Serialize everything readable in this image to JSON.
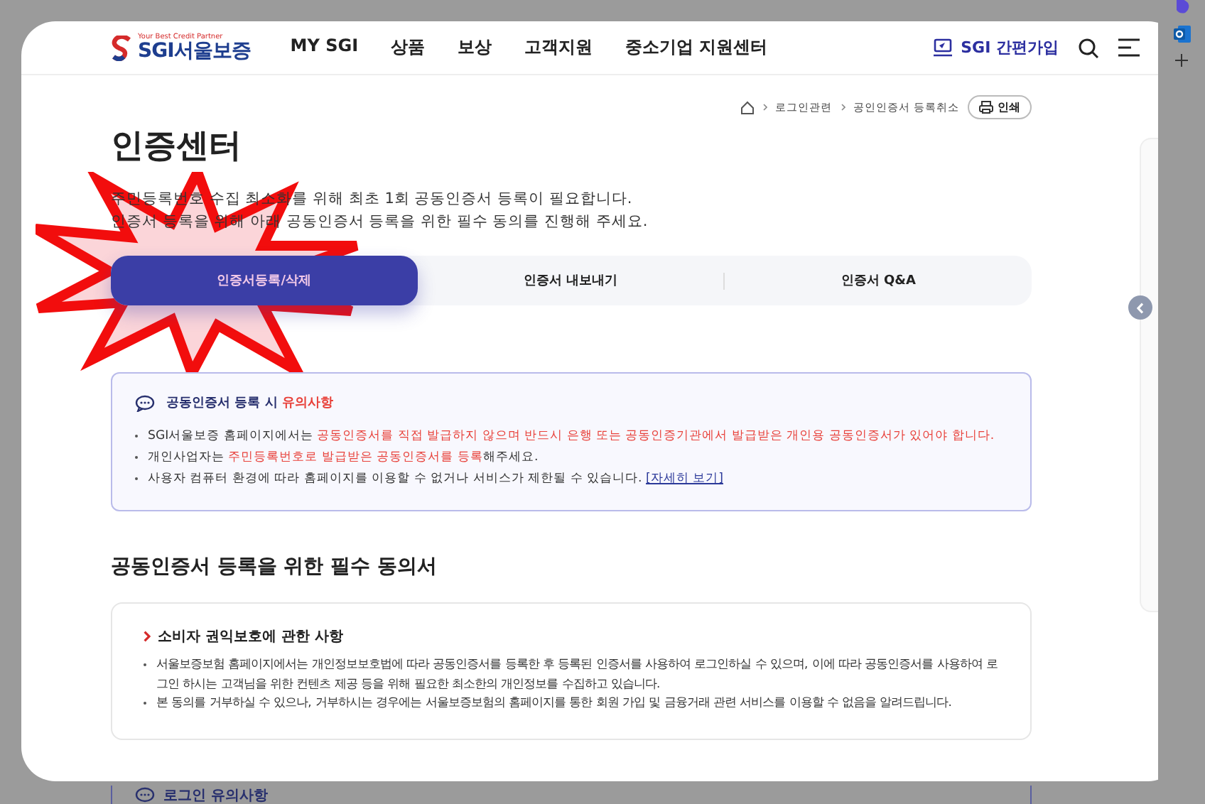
{
  "header": {
    "logo_tagline": "Your Best Credit Partner",
    "logo_text": "SGI서울보증",
    "nav": [
      "MY SGI",
      "상품",
      "보상",
      "고객지원",
      "중소기업 지원센터"
    ],
    "signup": "SGI 간편가입"
  },
  "breadcrumb": [
    "로그인관련",
    "공인인증서 등록취소"
  ],
  "print_button": "인쇄",
  "title": "인증센터",
  "intro": [
    "주민등록번호 수집 최소화를 위해 최초 1회 공동인증서 등록이 필요합니다.",
    "인증서 등록을 위해 아래 공동인증서 등록을 위한 필수 동의를 진행해 주세요."
  ],
  "tabs": [
    {
      "label": "인증서등록/삭제",
      "selected": true
    },
    {
      "label": "인증서 내보내기",
      "selected": false
    },
    {
      "label": "인증서 Q&A",
      "selected": false
    }
  ],
  "notice": {
    "title": [
      {
        "kind": "plain",
        "text": "공동인증서 등록 시 "
      },
      {
        "kind": "highlight",
        "text": "유의사항"
      }
    ],
    "items": [
      [
        {
          "kind": "plain",
          "text": "SGI서울보증 홈페이지에서는 "
        },
        {
          "kind": "highlight",
          "text": "공동인증서를 직접 발급하지 않으며 반드시 은행 또는 공동인증기관에서 발급받은 개인용 공동인증서가 있어야 합니다."
        }
      ],
      [
        {
          "kind": "plain",
          "text": "개인사업자는 "
        },
        {
          "kind": "highlight",
          "text": "주민등록번호로 발급받은 공동인증서를 등록"
        },
        {
          "kind": "plain",
          "text": "해주세요."
        }
      ],
      [
        {
          "kind": "plain",
          "text": "사용자 컴퓨터 환경에 따라 홈페이지를 이용할 수 없거나 서비스가 제한될 수 있습니다. "
        },
        {
          "kind": "link",
          "text": "[자세히 보기]"
        }
      ]
    ]
  },
  "consent_heading": "공동인증서 등록을 위한 필수 동의서",
  "consent_sections": [
    {
      "title": "소비자 권익보호에 관한 사항",
      "items": [
        "서울보증보험 홈페이지에서는 개인정보보호법에 따라 공동인증서를 등록한 후 등록된 인증서를 사용하여 로그인하실 수 있으며, 이에 따라 공동인증서를 사용하여 로그인 하시는 고객님을 위한 컨텐츠 제공 등을 위해 필요한 최소한의 개인정보를 수집하고 있습니다.",
        "본 동의를 거부하실 수 있으나, 거부하시는 경우에는 서울보증보험의 홈페이지를 통한 회원 가입 및 금융거래 관련 서비스를 이용할 수 없음을 알려드립니다."
      ]
    }
  ],
  "next_section": {
    "title": "로그인 유의사항"
  }
}
